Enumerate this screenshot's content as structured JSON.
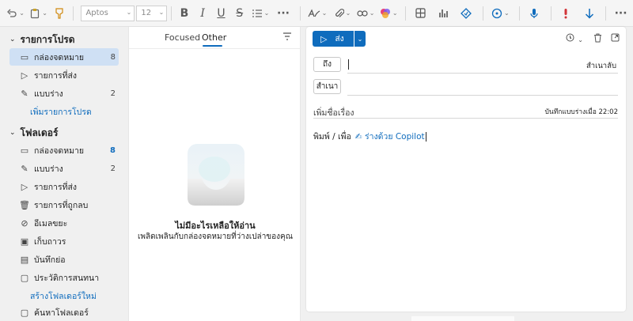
{
  "ribbon": {
    "font_name": "Aptos",
    "font_size": "12",
    "icons": [
      "undo-icon",
      "paste-icon",
      "format-painter-icon",
      "bold-icon",
      "italic-icon",
      "underline-icon",
      "strikethrough-icon",
      "list-icon",
      "more-icon",
      "styles-icon",
      "attach-icon",
      "link-icon",
      "copilot-icon",
      "table-icon",
      "chart-icon",
      "sensitivity-icon",
      "dictate-icon",
      "importance-high-icon",
      "importance-low-icon",
      "more-icon"
    ],
    "labels": {
      "bold": "B",
      "italic": "I",
      "underline": "U",
      "strike": "S",
      "more": "···"
    }
  },
  "nav": {
    "favorites_title": "รายการโปรด",
    "favorites": [
      {
        "label": "กล่องจดหมาย",
        "count": "8",
        "icon": "inbox-icon"
      },
      {
        "label": "รายการที่ส่ง",
        "count": "",
        "icon": "send-icon"
      },
      {
        "label": "แบบร่าง",
        "count": "2",
        "icon": "draft-icon"
      }
    ],
    "add_favorite": "เพิ่มรายการโปรด",
    "folders_title": "โฟลเดอร์",
    "folders": [
      {
        "label": "กล่องจดหมาย",
        "count": "8",
        "icon": "inbox-icon"
      },
      {
        "label": "แบบร่าง",
        "count": "2",
        "icon": "draft-icon"
      },
      {
        "label": "รายการที่ส่ง",
        "count": "",
        "icon": "send-icon"
      },
      {
        "label": "รายการที่ถูกลบ",
        "count": "",
        "icon": "trash-icon"
      },
      {
        "label": "อีเมลขยะ",
        "count": "",
        "icon": "junk-icon"
      },
      {
        "label": "เก็บถาวร",
        "count": "",
        "icon": "archive-icon"
      },
      {
        "label": "บันทึกย่อ",
        "count": "",
        "icon": "notes-icon"
      },
      {
        "label": "ประวัติการสนทนา",
        "count": "",
        "icon": "folder-icon"
      }
    ],
    "create_folder": "สร้างโฟลเดอร์ใหม่",
    "search_folders": "ค้นหาโฟลเดอร์"
  },
  "list": {
    "tab_focused": "Focused",
    "tab_other": "Other",
    "empty_title": "ไม่มีอะไรเหลือให้อ่าน",
    "empty_subtitle": "เพลิดเพลินกับกล่องจดหมายที่ว่างเปล่าของคุณ"
  },
  "compose": {
    "send_label": "ส่ง",
    "to_label": "ถึง",
    "cc_label": "สำเนา",
    "bcc_label": "สำเนาลับ",
    "subject_placeholder": "เพิ่มชื่อเรื่อง",
    "draft_saved": "บันทึกแบบร่างเมื่อ 22:02",
    "body_hint": "พิมพ์ / เพื่อ",
    "copilot_link": "ร่างด้วย Copilot"
  },
  "colors": {
    "accent": "#0f6cbd",
    "selected": "#cfe0f4"
  }
}
